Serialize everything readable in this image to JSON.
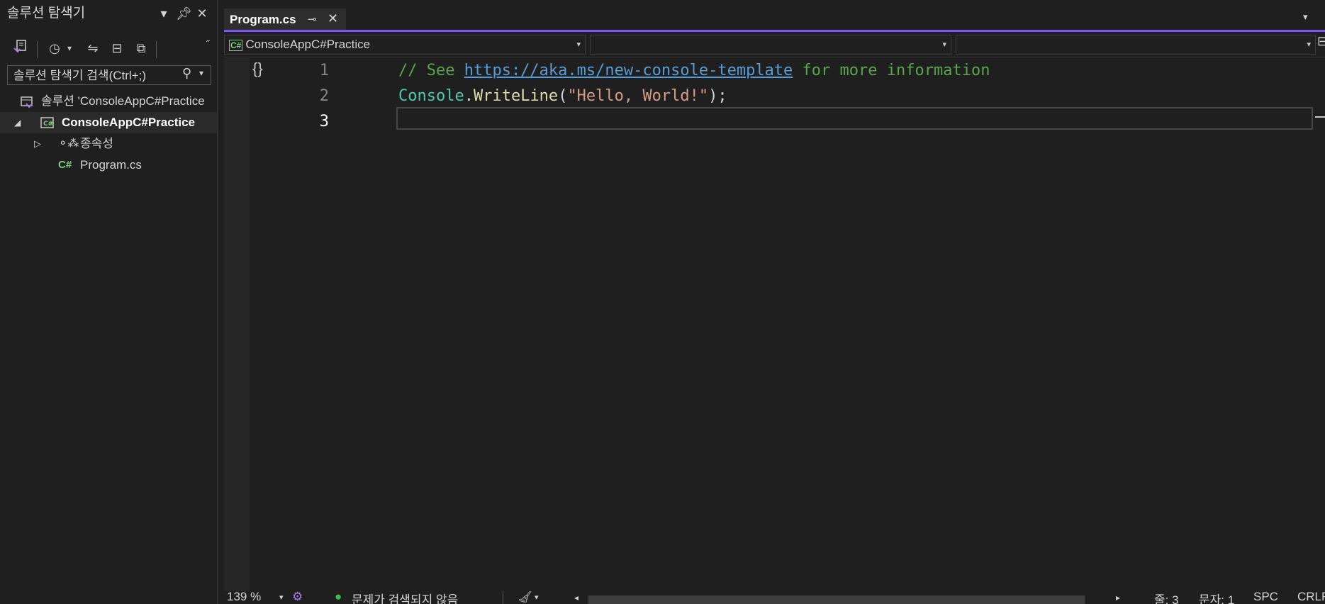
{
  "solution_explorer": {
    "title": "솔루션 탐색기",
    "search_placeholder": "솔루션 탐색기 검색(Ctrl+;)",
    "tree": [
      {
        "label": "솔루션 'ConsoleAppC#Practice"
      },
      {
        "label": "ConsoleAppC#Practice"
      },
      {
        "label": "종속성"
      },
      {
        "label": "Program.cs"
      }
    ]
  },
  "editor": {
    "tab": {
      "label": "Program.cs"
    },
    "nav": {
      "project": "ConsoleAppC#Practice",
      "type": "",
      "member": ""
    },
    "lines": [
      {
        "num": "1",
        "comment_prefix": "// See ",
        "url": "https://aka.ms/new-console-template",
        "comment_suffix": " for more information"
      },
      {
        "num": "2",
        "cls": "Console",
        "dot": ".",
        "method": "WriteLine",
        "open": "(",
        "string": "\"Hello, World!\"",
        "close": ");"
      },
      {
        "num": "3"
      }
    ]
  },
  "statusbar": {
    "zoom": "139 %",
    "issues": "문제가 검색되지 않음",
    "line": "줄: 3",
    "col": "문자: 1",
    "spacing": "SPC",
    "eol": "CRLF"
  },
  "colors": {
    "accent": "#7a5ad4",
    "comment": "#57a64a",
    "string": "#d69d85",
    "class": "#4ec9b0",
    "method": "#dcdcaa"
  }
}
